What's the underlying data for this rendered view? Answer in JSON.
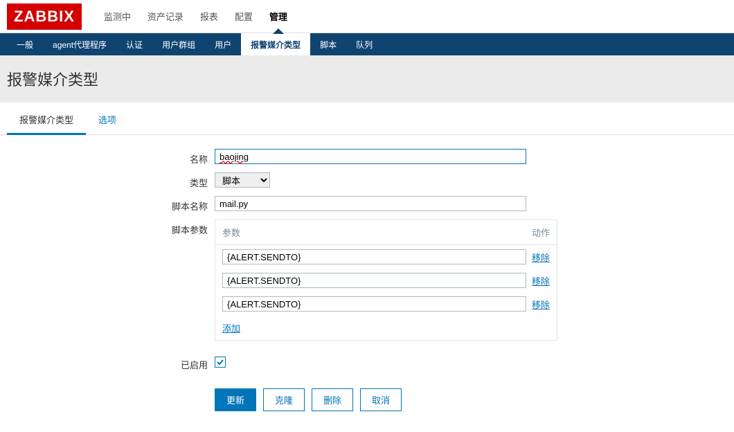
{
  "logo": "ZABBIX",
  "topNav": {
    "items": [
      {
        "label": "监测中",
        "active": false
      },
      {
        "label": "资产记录",
        "active": false
      },
      {
        "label": "报表",
        "active": false
      },
      {
        "label": "配置",
        "active": false
      },
      {
        "label": "管理",
        "active": true
      }
    ]
  },
  "subNav": {
    "items": [
      {
        "label": "一般",
        "active": false
      },
      {
        "label": "agent代理程序",
        "active": false
      },
      {
        "label": "认证",
        "active": false
      },
      {
        "label": "用户群组",
        "active": false
      },
      {
        "label": "用户",
        "active": false
      },
      {
        "label": "报警媒介类型",
        "active": true
      },
      {
        "label": "脚本",
        "active": false
      },
      {
        "label": "队列",
        "active": false
      }
    ]
  },
  "page": {
    "title": "报警媒介类型"
  },
  "tabs": {
    "items": [
      {
        "label": "报警媒介类型",
        "active": true
      },
      {
        "label": "选项",
        "active": false
      }
    ]
  },
  "form": {
    "name_label": "名称",
    "name_value": "baojing",
    "type_label": "类型",
    "type_value": "脚本",
    "script_name_label": "脚本名称",
    "script_name_value": "mail.py",
    "script_params_label": "脚本参数",
    "params_header_param": "参数",
    "params_header_action": "动作",
    "params": [
      {
        "value": "{ALERT.SENDTO}"
      },
      {
        "value": "{ALERT.SENDTO}"
      },
      {
        "value": "{ALERT.SENDTO}"
      }
    ],
    "remove_label": "移除",
    "add_label": "添加",
    "enabled_label": "已启用",
    "enabled_checked": true
  },
  "buttons": {
    "update": "更新",
    "clone": "克隆",
    "delete": "删除",
    "cancel": "取消"
  }
}
